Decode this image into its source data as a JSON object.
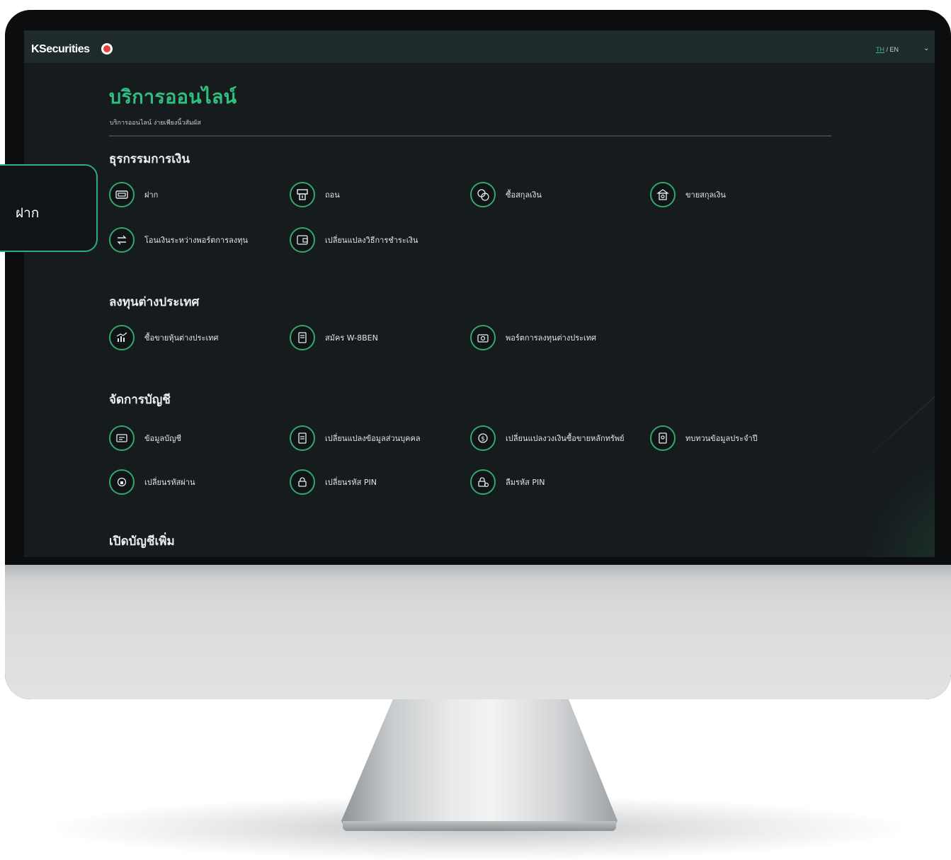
{
  "colors": {
    "accent": "#2fbf7e",
    "screen_bg": "#161b1d",
    "topbar_bg": "#1f2a2d",
    "icon_ring": "#2fa96f"
  },
  "header": {
    "brand": "KSecurities",
    "lang_th": "TH",
    "lang_sep": "/",
    "lang_en": "EN"
  },
  "page": {
    "title": "บริการออนไลน์",
    "subtitle": "บริการออนไลน์ ง่ายเพียงนิ้วสัมผัส"
  },
  "sections": [
    {
      "title": "ธุรกรรมการเงิน",
      "items": [
        {
          "label": "ฝาก",
          "icon": "deposit-icon"
        },
        {
          "label": "ถอน",
          "icon": "withdraw-icon"
        },
        {
          "label": "ซื้อสกุลเงิน",
          "icon": "buy-currency-icon"
        },
        {
          "label": "ขายสกุลเงิน",
          "icon": "sell-currency-icon"
        },
        {
          "label": "โอนเงินระหว่างพอร์ตการลงทุน",
          "icon": "transfer-icon"
        },
        {
          "label": "เปลี่ยนแปลงวิธีการชำระเงิน",
          "icon": "payment-method-icon"
        }
      ]
    },
    {
      "title": "ลงทุนต่างประเทศ",
      "items": [
        {
          "label": "ซื้อขายหุ้นต่างประเทศ",
          "icon": "stock-chart-icon"
        },
        {
          "label": "สมัคร W-8BEN",
          "icon": "form-icon"
        },
        {
          "label": "พอร์ตการลงทุนต่างประเทศ",
          "icon": "portfolio-icon"
        }
      ]
    },
    {
      "title": "จัดการบัญชี",
      "items": [
        {
          "label": "ข้อมูลบัญชี",
          "icon": "account-info-icon"
        },
        {
          "label": "เปลี่ยนแปลงข้อมูลส่วนบุคคล",
          "icon": "personal-info-icon"
        },
        {
          "label": "เปลี่ยนแปลงวงเงินซื้อขายหลักทรัพย์",
          "icon": "credit-limit-icon"
        },
        {
          "label": "ทบทวนข้อมูลประจำปี",
          "icon": "annual-review-icon"
        },
        {
          "label": "เปลี่ยนรหัสผ่าน",
          "icon": "change-password-icon"
        },
        {
          "label": "เปลี่ยนรหัส PIN",
          "icon": "change-pin-icon"
        },
        {
          "label": "ลืมรหัส PIN",
          "icon": "forgot-pin-icon"
        }
      ]
    },
    {
      "title": "เปิดบัญชีเพิ่ม",
      "items": []
    }
  ],
  "callout": {
    "label": "ฝาก"
  }
}
